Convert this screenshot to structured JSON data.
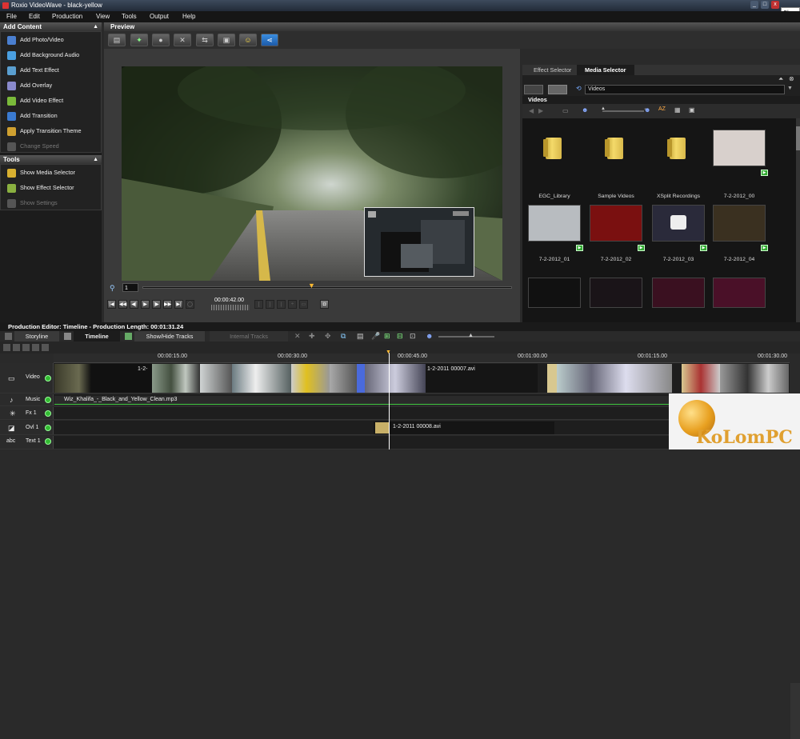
{
  "window": {
    "title": "Roxio VideoWave - black-yellow",
    "close_label": "Close"
  },
  "menu": [
    "File",
    "Edit",
    "Production",
    "View",
    "Tools",
    "Output",
    "Help"
  ],
  "add_content": {
    "header": "Add Content",
    "items": [
      {
        "label": "Add Photo/Video",
        "icon": "photo-video-icon",
        "color": "#4a7fd0",
        "enabled": true
      },
      {
        "label": "Add Background Audio",
        "icon": "music-note-icon",
        "color": "#4a9fe0",
        "enabled": true
      },
      {
        "label": "Add Text Effect",
        "icon": "text-effect-icon",
        "color": "#5a9fd0",
        "enabled": true
      },
      {
        "label": "Add Overlay",
        "icon": "overlay-icon",
        "color": "#8a8acc",
        "enabled": true
      },
      {
        "label": "Add Video Effect",
        "icon": "video-effect-icon",
        "color": "#7aba3a",
        "enabled": true
      },
      {
        "label": "Add Transition",
        "icon": "transition-icon",
        "color": "#3a7ad0",
        "enabled": true
      },
      {
        "label": "Apply Transition Theme",
        "icon": "transition-theme-icon",
        "color": "#cfa030",
        "enabled": true
      },
      {
        "label": "Change Speed",
        "icon": "speed-icon",
        "color": "#555",
        "enabled": false
      }
    ]
  },
  "tools": {
    "header": "Tools",
    "items": [
      {
        "label": "Show Media Selector",
        "icon": "media-selector-icon",
        "color": "#d8b030",
        "enabled": true
      },
      {
        "label": "Show Effect Selector",
        "icon": "effect-selector-icon",
        "color": "#8ab040",
        "enabled": true
      },
      {
        "label": "Show Settings",
        "icon": "settings-icon",
        "color": "#555",
        "enabled": false
      }
    ]
  },
  "preview": {
    "header": "Preview",
    "frame_value": "1",
    "timecode": "00:00:42.00"
  },
  "right_panel": {
    "tabs": [
      "Effect Selector",
      "Media Selector"
    ],
    "active_tab": "Media Selector",
    "folder_select": "Videos",
    "section": "Videos",
    "items": [
      {
        "label": "EGC_Library",
        "kind": "folder"
      },
      {
        "label": "Sample Videos",
        "kind": "folder"
      },
      {
        "label": "XSplit Recordings",
        "kind": "folder"
      },
      {
        "label": "7-2-2012_00",
        "kind": "video",
        "bg": "#d8d0cc"
      },
      {
        "label": "7-2-2012_01",
        "kind": "video",
        "bg": "#b8bcc0"
      },
      {
        "label": "7-2-2012_02",
        "kind": "video",
        "bg": "#7a1010"
      },
      {
        "label": "7-2-2012_03",
        "kind": "video",
        "bg": "#2a2a3a"
      },
      {
        "label": "7-2-2012_04",
        "kind": "video",
        "bg": "#3a3020"
      }
    ]
  },
  "timeline": {
    "header": "Production Editor: Timeline - Production Length: 00:01:31.24",
    "tabs": [
      "Storyline",
      "Timeline",
      "Show/Hide Tracks",
      "Internal Tracks"
    ],
    "ruler": [
      "00:00:15.00",
      "00:00:30.00",
      "00:00:45.00",
      "00:01:00.00",
      "00:01:15.00",
      "00:01:30.00"
    ],
    "tracks": [
      {
        "label": "Video",
        "icon": "video-track-icon"
      },
      {
        "label": "Music",
        "icon": "music-track-icon"
      },
      {
        "label": "Fx 1",
        "icon": "fx-track-icon"
      },
      {
        "label": "Ovl 1",
        "icon": "overlay-track-icon"
      },
      {
        "label": "Text 1",
        "icon": "text-track-icon"
      }
    ],
    "video_clip_labels": [
      "1-2-",
      "1-2-2011 00007.avi"
    ],
    "music_clip": "Wiz_Khalifa_-_Black_and_Yellow_Clean.mp3",
    "overlay_clip": "1-2-2011 00008.avi"
  },
  "watermark": {
    "text": "KoLomPC"
  }
}
